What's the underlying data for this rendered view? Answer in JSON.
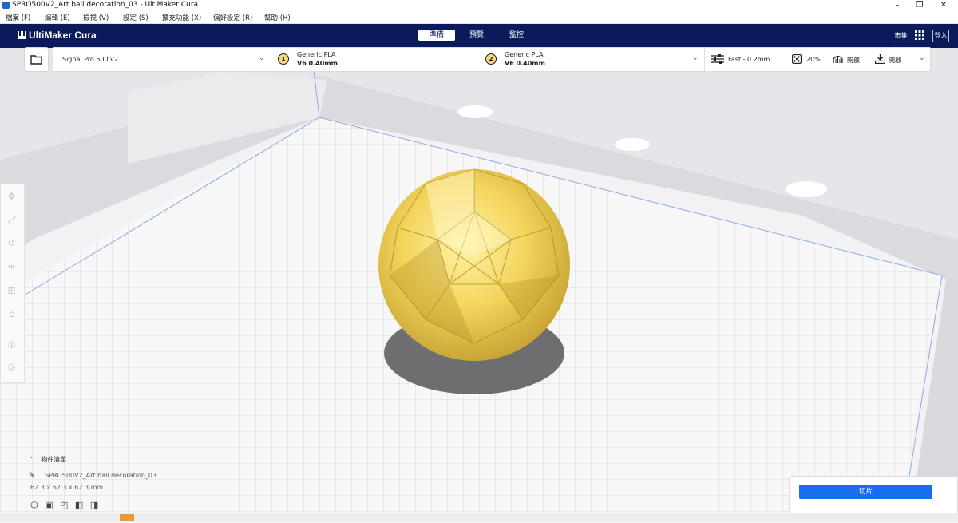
{
  "window": {
    "title": "SPRO500V2_Art ball decoration_03 - UltiMaker Cura",
    "minimize": "–",
    "maximize": "❐",
    "close": "✕"
  },
  "menu": {
    "items": [
      "檔案 (F)",
      "編輯 (E)",
      "檢視 (V)",
      "設定 (S)",
      "擴充功能 (X)",
      "偏好設定 (R)",
      "幫助 (H)"
    ]
  },
  "header": {
    "brand": "UltiMaker Cura",
    "stages": [
      "準備",
      "預覽",
      "監控"
    ],
    "active_stage": "準備",
    "marketplace": "市集",
    "signin": "登入"
  },
  "printer": {
    "name": "Signal Pro 500 v2"
  },
  "extruders": [
    {
      "number": "1",
      "material": "Generic PLA",
      "nozzle": "V6 0.40mm"
    },
    {
      "number": "2",
      "material": "Generic PLA",
      "nozzle": "V6 0.40mm"
    }
  ],
  "print_settings": {
    "profile": "Fast - 0.2mm",
    "infill": "20%",
    "support": "開啟",
    "adhesion": "開啟"
  },
  "object_list": {
    "header": "物件清單",
    "object_name": "SPRO500V2_Art ball decoration_03",
    "dimensions": "62.3 x 62.3 x 62.3 mm"
  },
  "slice": {
    "button": "切片"
  },
  "colors": {
    "header_bg": "#0b1a5b",
    "accent": "#196ef0",
    "model": "#f2d35a"
  },
  "icons": {
    "open": "folder-icon",
    "settings": "sliders-icon",
    "infill": "dice-icon",
    "support": "support-icon",
    "adhesion": "adhesion-icon",
    "apps": "grid-icon"
  }
}
